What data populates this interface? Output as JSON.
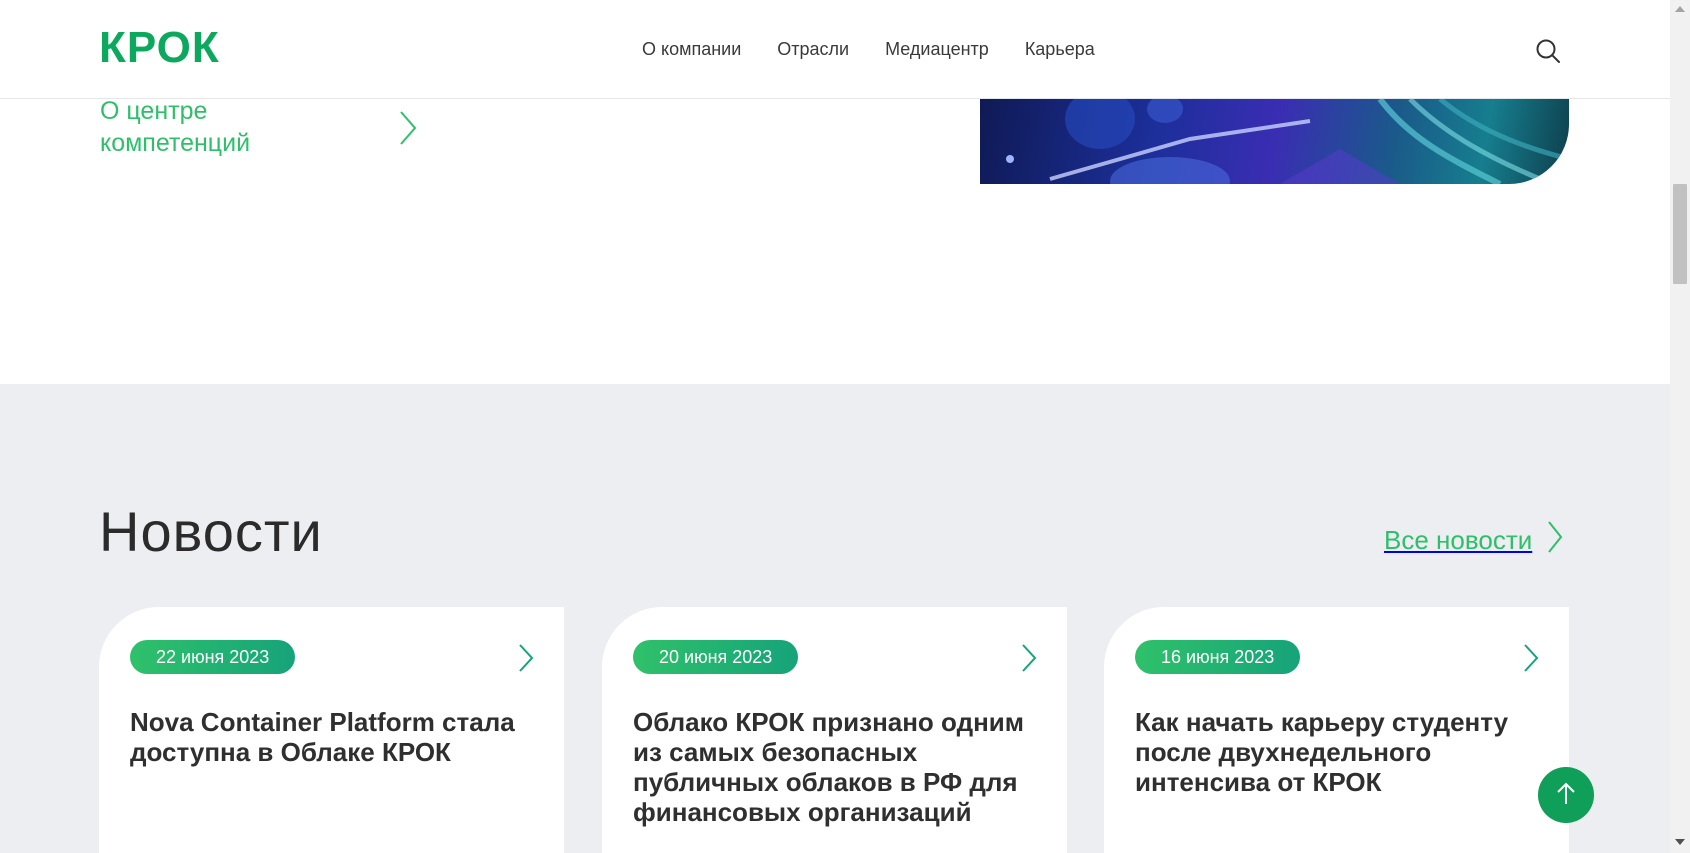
{
  "header": {
    "logo": "КРОК",
    "nav": [
      "О компании",
      "Отрасли",
      "Медиацентр",
      "Карьера"
    ],
    "search_icon": "search-icon"
  },
  "competence": {
    "label": "О центре компетенций",
    "arrow_icon": "chevron-right-icon"
  },
  "news": {
    "title": "Новости",
    "all_news_label": "Все новости",
    "cards": [
      {
        "date": "22 июня 2023",
        "headline": "Nova Container Platform стала доступна в Облаке КРОК"
      },
      {
        "date": "20 июня 2023",
        "headline": "Облако КРОК признано одним из самых безопасных публичных облаков в РФ для финансовых организаций"
      },
      {
        "date": "16 июня 2023",
        "headline": "Как начать карьеру студенту после двухнедельного интенсива от КРОК"
      }
    ]
  },
  "colors": {
    "brand": "#0ba85d",
    "accent_green": "#2fbf6b",
    "section_bg": "#eceef2",
    "scroll_top_button": "#0f9f58"
  },
  "scroll_top_icon": "arrow-up-icon"
}
